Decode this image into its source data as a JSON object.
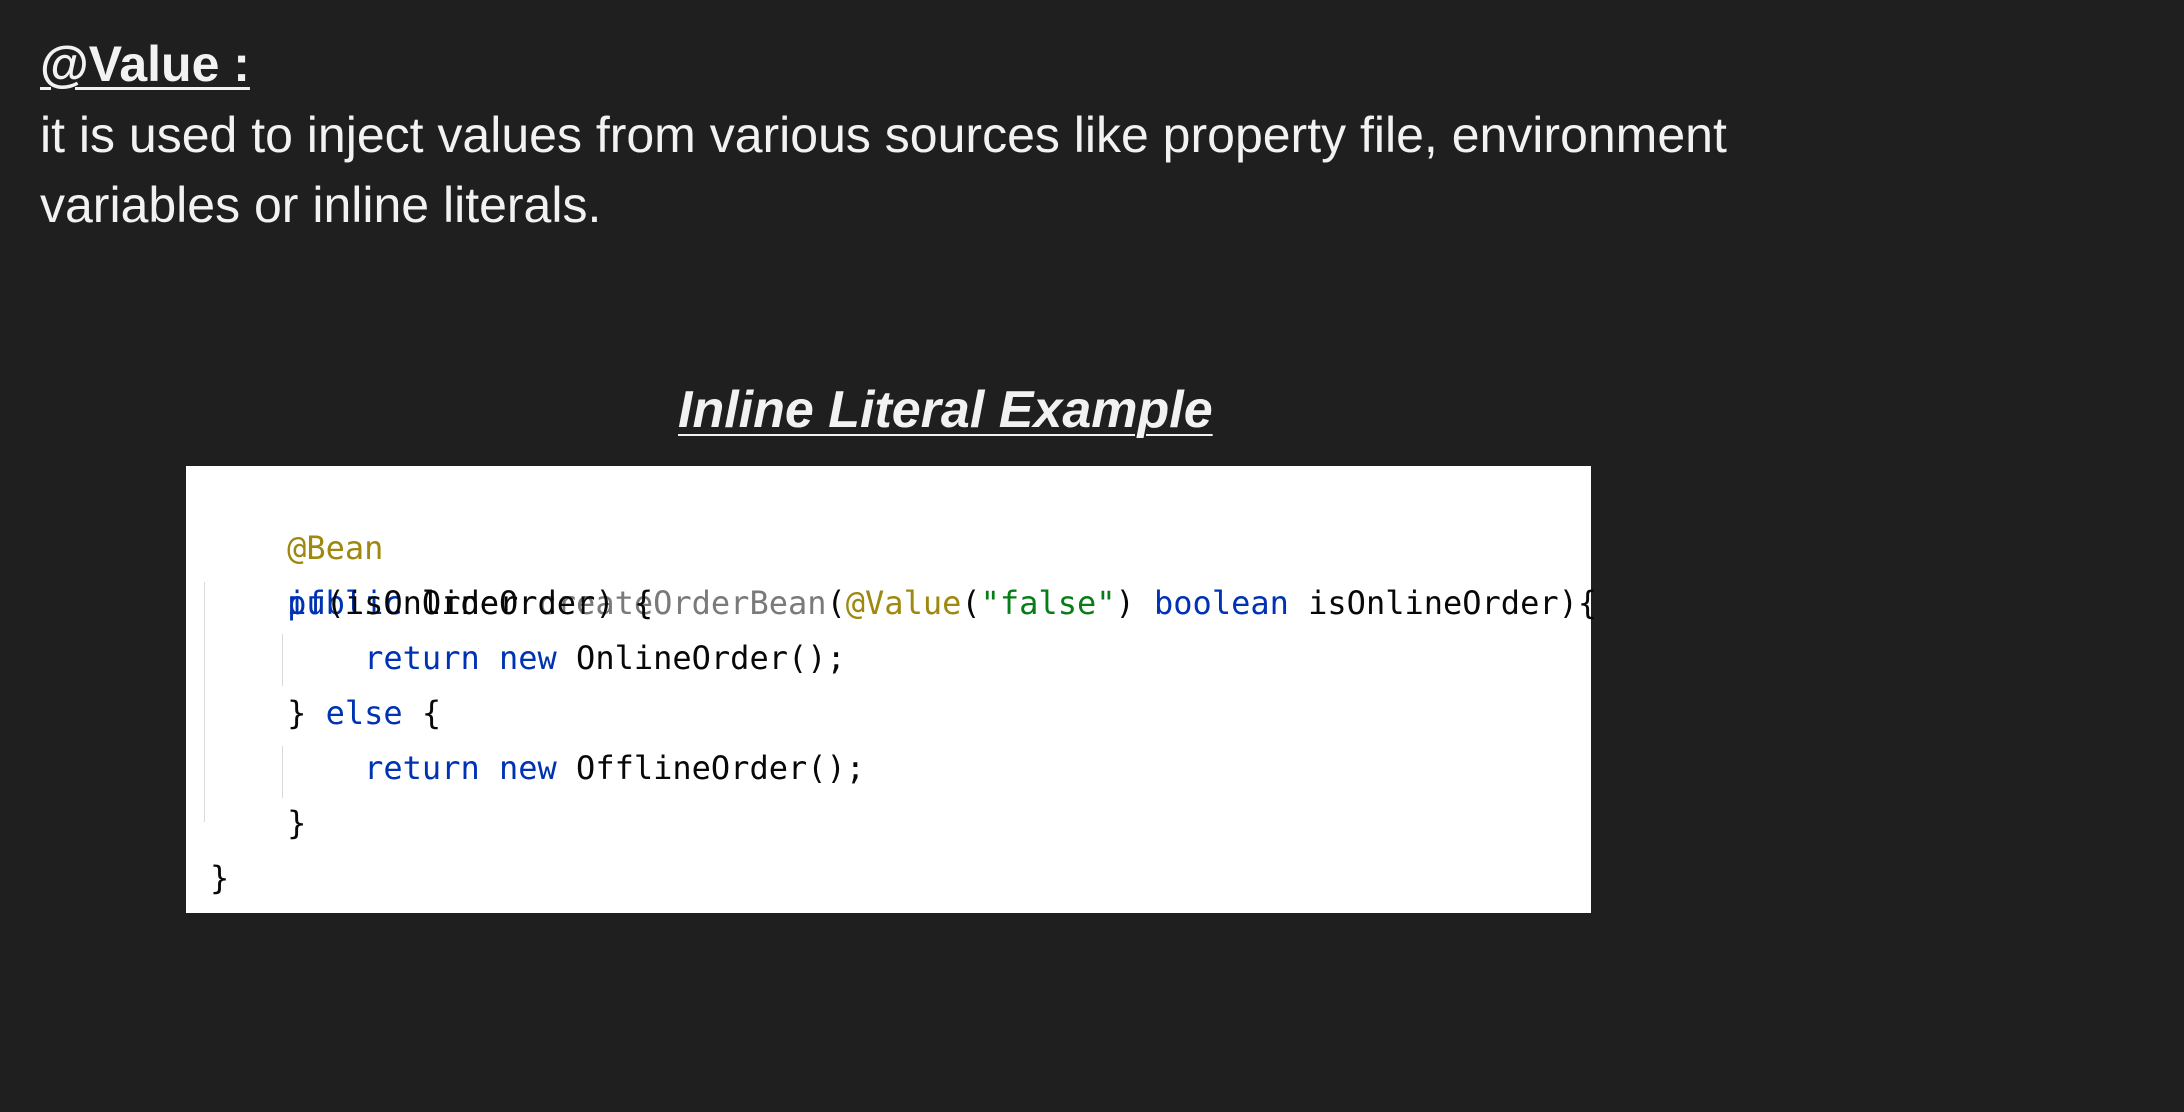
{
  "slide": {
    "heading": "@Value :",
    "description": "it is used to inject values from various sources like property file, environment variables or inline literals.",
    "example_title": "Inline Literal Example"
  },
  "code": {
    "line1": {
      "annotation": "@Bean"
    },
    "line2": {
      "kw_public": "public",
      "type": " Order ",
      "method": "createOrderBean",
      "paren_open": "(",
      "annotation": "@Value",
      "paren_open2": "(",
      "string": "\"false\"",
      "paren_close": ") ",
      "kw_boolean": "boolean",
      "param": " isOnlineOrder){"
    },
    "line3": {
      "kw_if": "if",
      "rest": "(isOnlineOrder) {"
    },
    "line4": {
      "kw_return": "return",
      "kw_new": " new",
      "rest": " OnlineOrder();"
    },
    "line5": {
      "brace": "} ",
      "kw_else": "else",
      "rest": " {"
    },
    "line6": {
      "kw_return": "return",
      "kw_new": " new",
      "rest": " OfflineOrder();"
    },
    "line7": {
      "brace": "}"
    },
    "line8": {
      "brace": "}"
    }
  },
  "colors": {
    "background": "#1f1f1f",
    "text": "#f2f2f2",
    "code_background": "#ffffff",
    "annotation": "#9e880d",
    "keyword": "#0033b3",
    "string": "#067d17",
    "method_name": "#7a7a7a"
  }
}
